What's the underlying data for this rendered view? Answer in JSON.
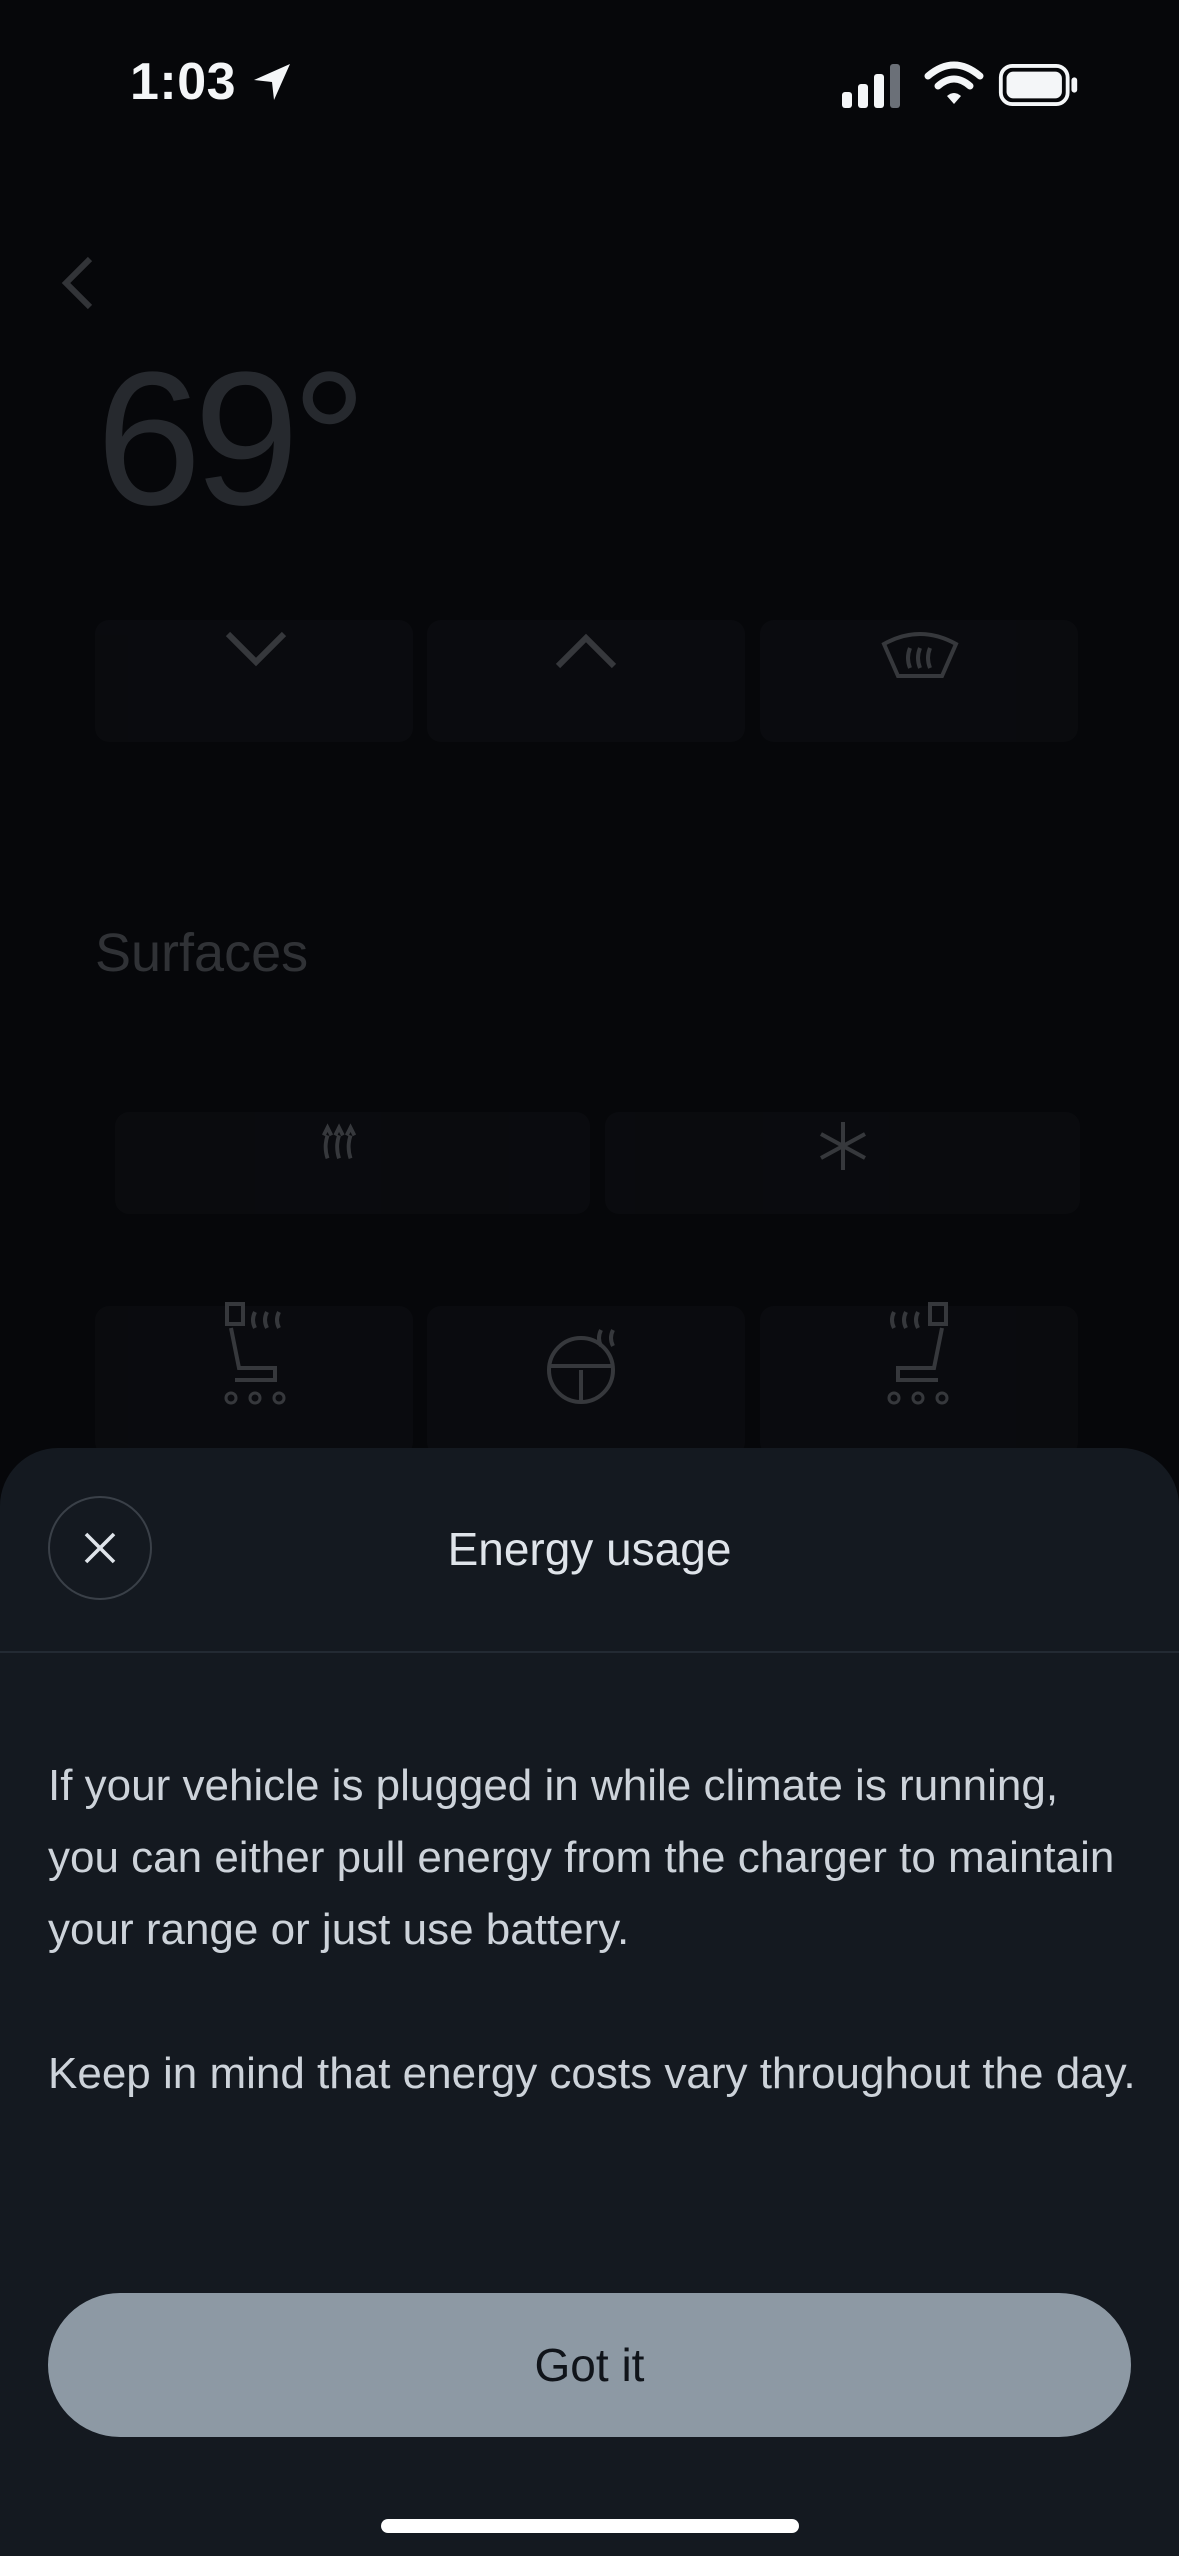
{
  "status_bar": {
    "time": "1:03",
    "icons": [
      "location-arrow-icon",
      "cellular-signal-icon",
      "wifi-icon",
      "battery-icon"
    ]
  },
  "background": {
    "temperature": "69°",
    "surfaces_title": "Surfaces",
    "icons": [
      "back-chevron-icon",
      "chevron-down-icon",
      "chevron-up-icon",
      "defrost-icon",
      "heat-icon",
      "snowflake-icon",
      "heated-seat-left-icon",
      "heated-steering-wheel-icon",
      "heated-seat-right-icon"
    ]
  },
  "sheet": {
    "title": "Energy usage",
    "paragraph1": "If your vehicle is plugged in while climate is running, you can either pull energy from the charger to maintain your range or just use battery.",
    "paragraph2": "Keep in mind that energy costs vary throughout the day.",
    "primary_button": "Got it"
  },
  "colors": {
    "background": "#06070a",
    "sheet": "#141920",
    "button": "#8d99a4",
    "text": "#cdd3da"
  }
}
